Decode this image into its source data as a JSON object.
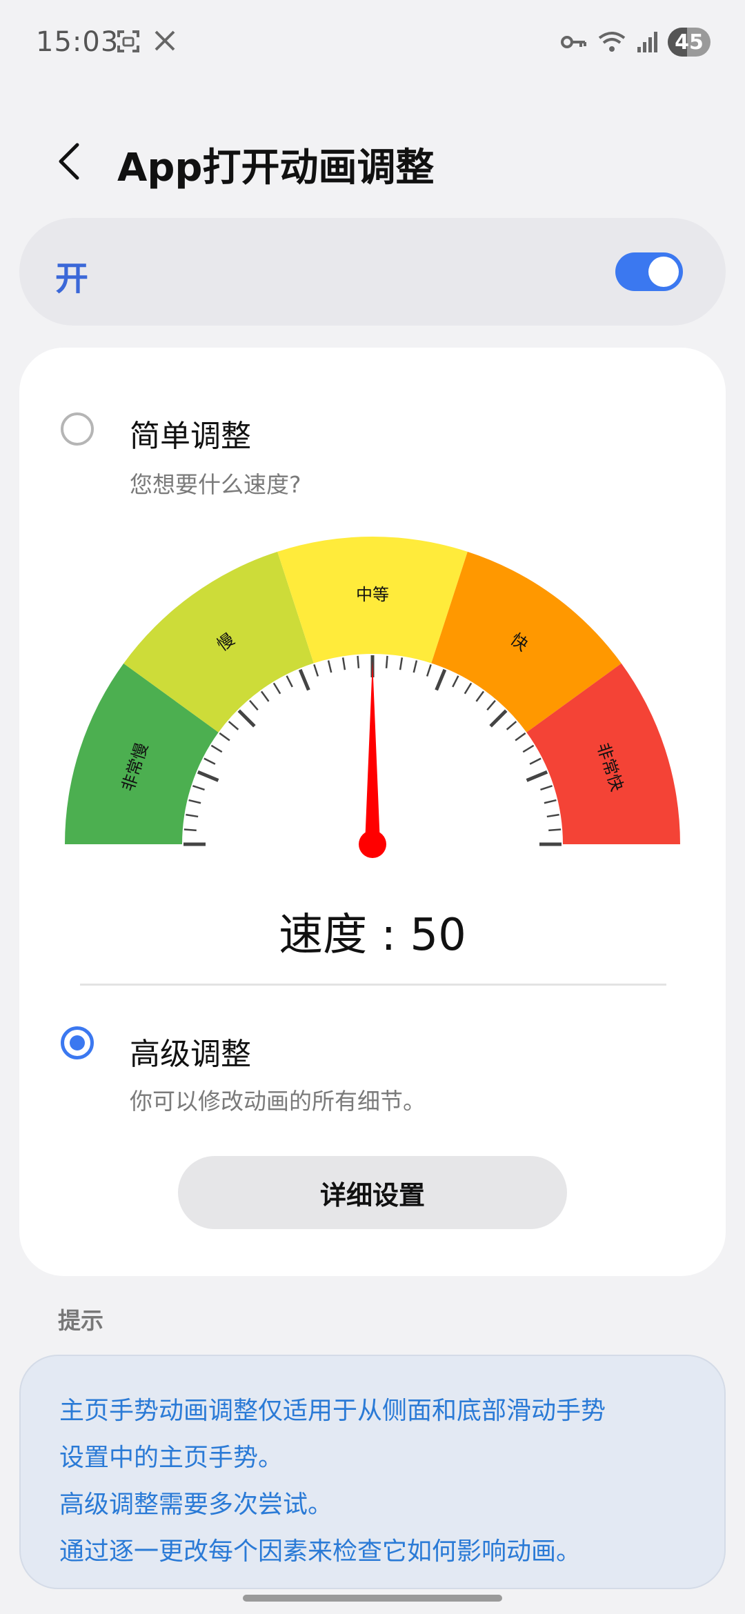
{
  "status_bar": {
    "time": "15:03",
    "left_icons": [
      "screenshot-icon",
      "x-icon"
    ],
    "right_icons": [
      "key-icon",
      "wifi-icon",
      "signal-icon"
    ],
    "battery": "45"
  },
  "header": {
    "title": "App打开动画调整",
    "back_icon": "chevron-left-icon"
  },
  "master_switch": {
    "label": "开",
    "state": "on",
    "accent": "#3b78f0",
    "label_color": "#3b68d8"
  },
  "simple": {
    "title": "简单调整",
    "subtitle": "您想要什么速度?",
    "selected": false,
    "gauge": {
      "segments": [
        {
          "label": "非常慢",
          "color": "#4caf50"
        },
        {
          "label": "慢",
          "color": "#cddc39"
        },
        {
          "label": "中等",
          "color": "#ffeb3b"
        },
        {
          "label": "快",
          "color": "#ff9800"
        },
        {
          "label": "非常快",
          "color": "#f44336"
        }
      ],
      "value": 50,
      "min": 0,
      "max": 100,
      "needle_color": "#ff0000"
    },
    "speed_text": "速度 : 50"
  },
  "advanced": {
    "title": "高级调整",
    "subtitle": "你可以修改动画的所有细节。",
    "selected": true,
    "button_label": "详细设置"
  },
  "tips": {
    "heading": "提示",
    "lines": [
      "主页手势动画调整仅适用于从侧面和底部滑动手势",
      "设置中的主页手势。",
      "高级调整需要多次尝试。",
      "通过逐一更改每个因素来检查它如何影响动画。"
    ],
    "text_color": "#2a7ad6"
  }
}
